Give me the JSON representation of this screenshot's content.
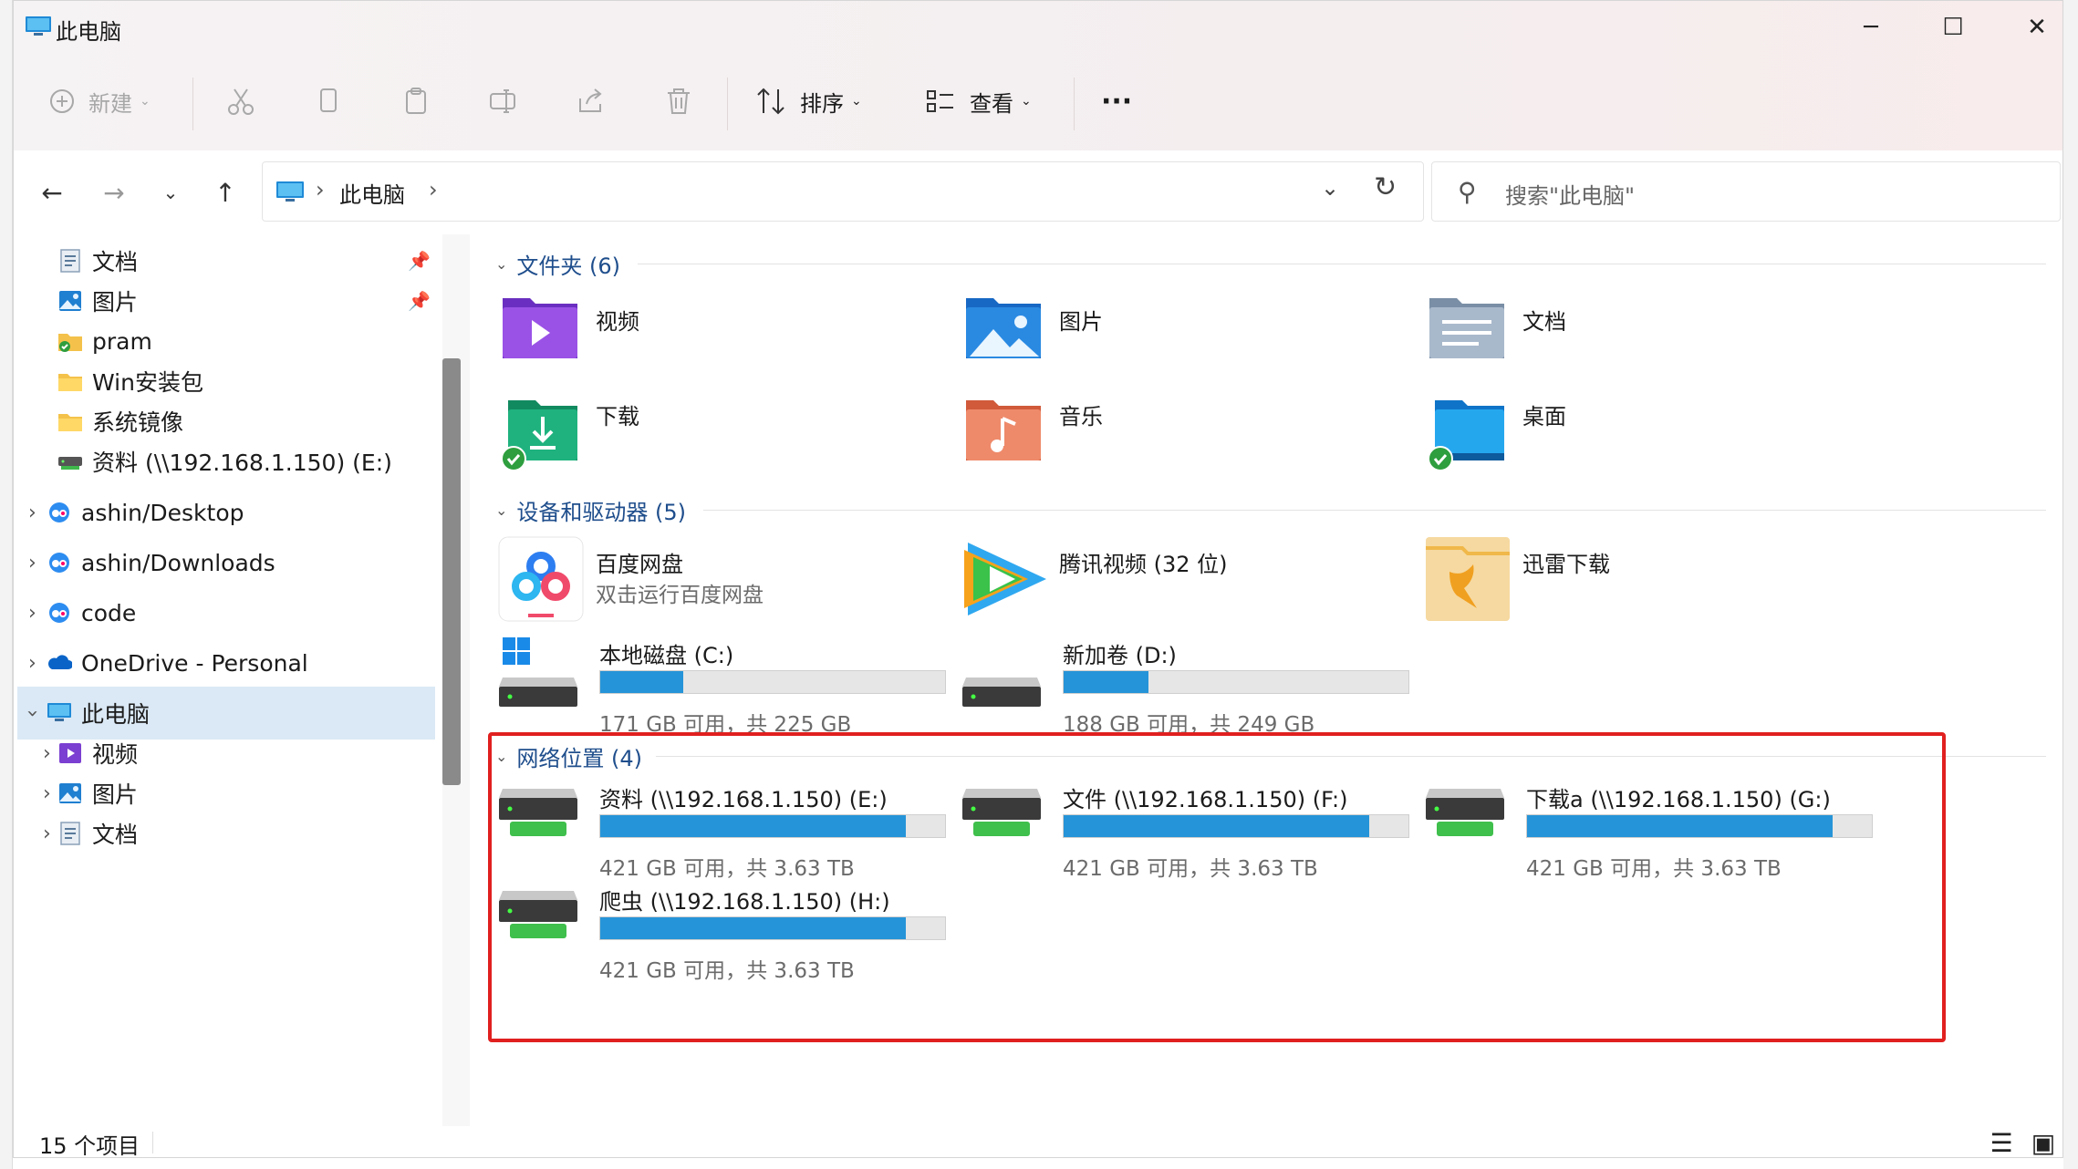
{
  "window": {
    "title": "此电脑",
    "minimize": "─",
    "maximize": "☐",
    "close": "✕"
  },
  "toolbar": {
    "new_label": "新建",
    "sort_label": "排序",
    "view_label": "查看",
    "more_label": "···"
  },
  "nav": {
    "breadcrumb": "此电脑",
    "search_placeholder": "搜索\"此电脑\""
  },
  "sidebar": {
    "items": [
      {
        "label": "文档",
        "icon": "document-icon"
      },
      {
        "label": "图片",
        "icon": "pictures-icon"
      },
      {
        "label": "pram",
        "icon": "folder-synced-icon"
      },
      {
        "label": "Win安装包",
        "icon": "folder-icon"
      },
      {
        "label": "系统镜像",
        "icon": "folder-icon"
      },
      {
        "label": "资料 (\\\\192.168.1.150) (E:)",
        "icon": "network-drive-icon"
      },
      {
        "label": "ashin/Desktop",
        "icon": "baidu-cloud-icon"
      },
      {
        "label": "ashin/Downloads",
        "icon": "baidu-cloud-icon"
      },
      {
        "label": "code",
        "icon": "baidu-cloud-icon"
      },
      {
        "label": "OneDrive - Personal",
        "icon": "onedrive-icon"
      },
      {
        "label": "此电脑",
        "icon": "this-pc-icon"
      },
      {
        "label": "视频",
        "icon": "videos-icon"
      },
      {
        "label": "图片",
        "icon": "pictures-icon"
      },
      {
        "label": "文档",
        "icon": "document-icon"
      }
    ]
  },
  "groups": {
    "folders": {
      "title": "文件夹 (6)",
      "items": [
        {
          "label": "视频",
          "icon": "videos-folder-icon"
        },
        {
          "label": "图片",
          "icon": "pictures-folder-icon"
        },
        {
          "label": "文档",
          "icon": "documents-folder-icon"
        },
        {
          "label": "下载",
          "icon": "downloads-folder-icon"
        },
        {
          "label": "音乐",
          "icon": "music-folder-icon"
        },
        {
          "label": "桌面",
          "icon": "desktop-folder-icon"
        }
      ]
    },
    "devices": {
      "title": "设备和驱动器 (5)",
      "items": [
        {
          "label": "百度网盘",
          "sub": "双击运行百度网盘",
          "icon": "baidu-netdisk-icon"
        },
        {
          "label": "腾讯视频 (32 位)",
          "icon": "tencent-video-icon"
        },
        {
          "label": "迅雷下载",
          "icon": "xunlei-icon"
        },
        {
          "label": "本地磁盘 (C:)",
          "sub": "171 GB 可用，共 225 GB",
          "fill": 0.24,
          "icon": "system-drive-icon"
        },
        {
          "label": "新加卷 (D:)",
          "sub": "188 GB 可用，共 249 GB",
          "fill": 0.245,
          "icon": "drive-icon"
        }
      ]
    },
    "network": {
      "title": "网络位置 (4)",
      "items": [
        {
          "label": "资料 (\\\\192.168.1.150) (E:)",
          "sub": "421 GB 可用，共 3.63 TB",
          "fill": 0.887
        },
        {
          "label": "文件 (\\\\192.168.1.150) (F:)",
          "sub": "421 GB 可用，共 3.63 TB",
          "fill": 0.887
        },
        {
          "label": "下载a (\\\\192.168.1.150) (G:)",
          "sub": "421 GB 可用，共 3.63 TB",
          "fill": 0.887
        },
        {
          "label": "爬虫 (\\\\192.168.1.150) (H:)",
          "sub": "421 GB 可用，共 3.63 TB",
          "fill": 0.887
        }
      ]
    }
  },
  "status": {
    "count": "15 个项目"
  },
  "colors": {
    "accent": "#2694d8",
    "highlight": "#e0201f",
    "group_header": "#1f4e8c"
  }
}
